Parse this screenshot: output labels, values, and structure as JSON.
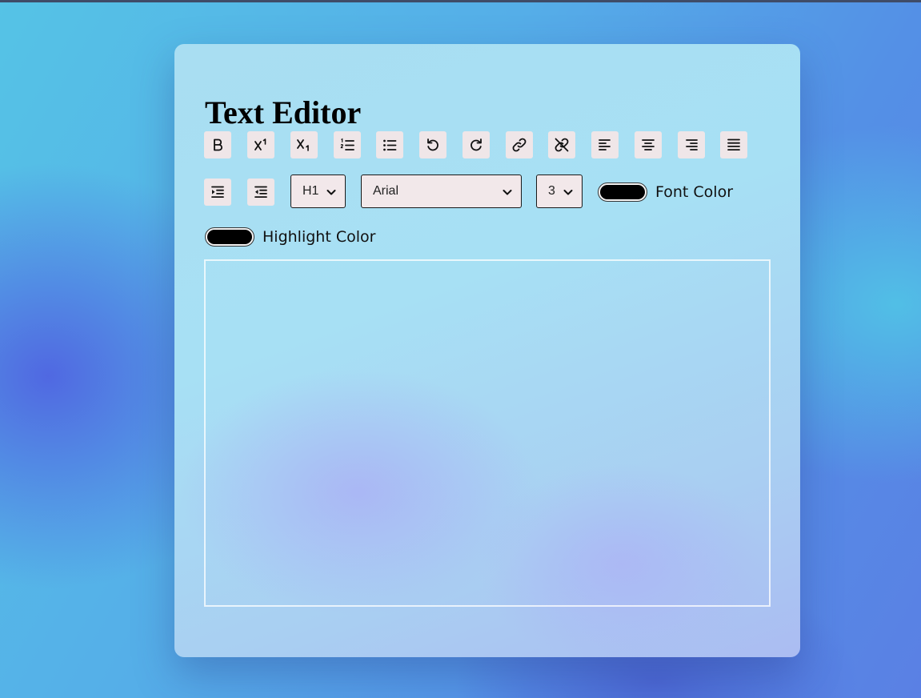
{
  "page": {
    "title": "Text Editor"
  },
  "toolbar": {
    "buttons": [
      {
        "name": "bold-button",
        "icon": "bold-icon"
      },
      {
        "name": "superscript-button",
        "icon": "superscript-icon"
      },
      {
        "name": "subscript-button",
        "icon": "subscript-icon"
      },
      {
        "name": "ordered-list-button",
        "icon": "ordered-list-icon"
      },
      {
        "name": "unordered-list-button",
        "icon": "unordered-list-icon"
      },
      {
        "name": "undo-button",
        "icon": "undo-icon"
      },
      {
        "name": "redo-button",
        "icon": "redo-icon"
      },
      {
        "name": "create-link-button",
        "icon": "link-icon"
      },
      {
        "name": "unlink-button",
        "icon": "unlink-icon"
      },
      {
        "name": "align-left-button",
        "icon": "align-left-icon"
      },
      {
        "name": "align-center-button",
        "icon": "align-center-icon"
      },
      {
        "name": "align-right-button",
        "icon": "align-right-icon"
      },
      {
        "name": "justify-button",
        "icon": "justify-icon"
      },
      {
        "name": "indent-button",
        "icon": "indent-icon"
      },
      {
        "name": "outdent-button",
        "icon": "outdent-icon"
      }
    ],
    "format_block": {
      "selected": "H1"
    },
    "font_name": {
      "selected": "Arial"
    },
    "font_size": {
      "selected": "3"
    },
    "font_color": {
      "label": "Font Color",
      "value": "#000000"
    },
    "highlight_color": {
      "label": "Highlight Color",
      "value": "#000000"
    }
  },
  "editor": {
    "content": ""
  },
  "colors": {
    "button_bg": "#efe6e8",
    "select_bg": "#f2e8ea",
    "editor_border": "#ffffff"
  }
}
